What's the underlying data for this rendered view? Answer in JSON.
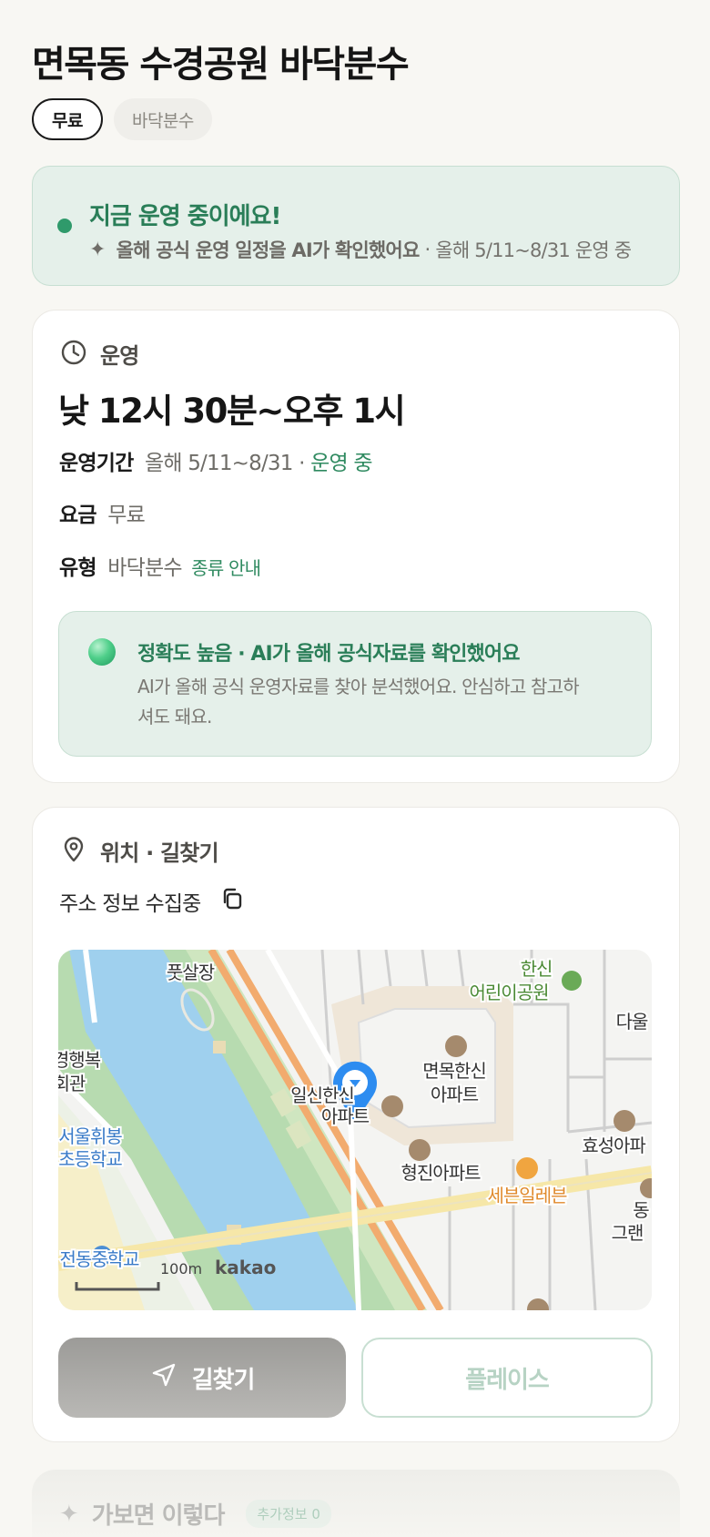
{
  "page": {
    "title": "면목동 수경공원 바닥분수"
  },
  "chips": [
    "무료",
    "바닥분수"
  ],
  "status": {
    "headline": "지금 운영 중이에요!",
    "sub_bold": "올해 공식 운영 일정을 AI가 확인했어요",
    "separator": "·",
    "sub_rest": "올해 5/11~8/31 운영 중"
  },
  "operation": {
    "section_label": "운영",
    "time": "낮 12시 30분~오후 1시",
    "period_key": "운영기간",
    "period_value": "올해 5/11~8/31",
    "period_sep": "·",
    "period_status": "운영 중",
    "fee_key": "요금",
    "fee_value": "무료",
    "type_key": "유형",
    "type_value": "바닥분수",
    "type_link": "종류 안내",
    "accuracy_title": "정확도 높음 · AI가 올해 공식자료를 확인했어요",
    "accuracy_desc": "AI가 올해 공식 운영자료를 찾아 분석했어요. 안심하고 참고하셔도 돼요."
  },
  "location": {
    "section_label": "위치 · 길찾기",
    "address": "주소 정보 수집중",
    "map_labels": {
      "futsal": "풋살장",
      "park1": "한신",
      "park2": "어린이공원",
      "dau": "다울",
      "apt1a": "면목한신",
      "apt1b": "아파트",
      "apt2a": "일신한신",
      "apt2b": "아파트",
      "apt3": "형진아파트",
      "hyosung": "효성아파",
      "seven": "세븐일레븐",
      "gyeong1": "경행복",
      "gyeong2": "회관",
      "school1": "서울휘봉",
      "school2": "초등학교",
      "school3": "전동중학교",
      "grand1": "동",
      "grand2": "그랜",
      "scale": "100m",
      "brand": "kakao"
    },
    "route_label": "길찾기",
    "place_label": "플레이스"
  },
  "peek": {
    "title": "가보면 이렇다",
    "badge": "추가정보 0"
  },
  "colors": {
    "accent": "#2f8a60",
    "status_bg": "#e5f0ea",
    "pin": "#2d8cf0"
  }
}
